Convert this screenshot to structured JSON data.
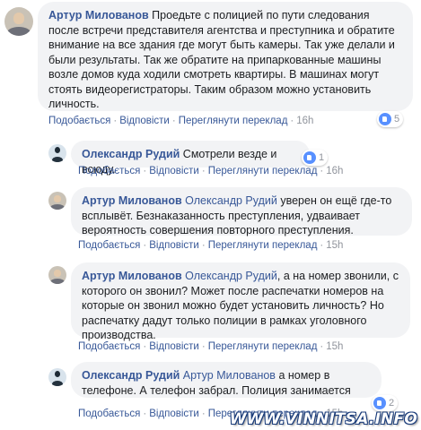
{
  "comments": [
    {
      "author": "Артур Милованов",
      "mention": "",
      "text": "Проедьте с полицией по пути следования после встречи представителя агентства и преступника и обратите внимание на все здания где могут быть камеры. Так уже делали и были результаты. Так же обратите на припаркованные машины возле домов куда ходили смотреть квартиры. В машинах могут стоять видеорегистраторы. Таким образом можно установить личность.",
      "like": "Подобається",
      "reply": "Відповісти",
      "translate": "Переглянути переклад",
      "time": "16h",
      "reactions": "5"
    },
    {
      "author": "Олександр Рудий",
      "mention": "",
      "text": "Смотрели везде и всюду.",
      "like": "Подобається",
      "reply": "Відповісти",
      "translate": "Переглянути переклад",
      "time": "16h",
      "reactions": "1"
    },
    {
      "author": "Артур Милованов",
      "mention": "Олександр Рудий",
      "text": "уверен он ещё где-то всплывёт. Безнаказанность преступления, удваивает вероятность совершения повторного преступления.",
      "like": "Подобається",
      "reply": "Відповісти",
      "translate": "Переглянути переклад",
      "time": "15h",
      "reactions": ""
    },
    {
      "author": "Артур Милованов",
      "mention": "Олександр Рудий",
      "text": ", а на номер звонили, с которого он звонил? Может после распечатки номеров на которые он звонил можно будет установить личность? Но распечатку дадут только полиции в рамках уголовного производства.",
      "like": "Подобається",
      "reply": "Відповісти",
      "translate": "Переглянути переклад",
      "time": "15h",
      "reactions": ""
    },
    {
      "author": "Олександр Рудий",
      "mention": "Артур Милованов",
      "text": "а номер в телефоне. А телефон забрал. Полиция занимается",
      "like": "Подобається",
      "reply": "Відповісти",
      "translate": "Переглянути переклад",
      "time": "15h",
      "reactions": "2"
    }
  ],
  "watermark": "WWW.VINNITSA.INFO",
  "colors": {
    "link": "#385898",
    "bubble": "#f2f3f5",
    "like": "#5890ff"
  }
}
